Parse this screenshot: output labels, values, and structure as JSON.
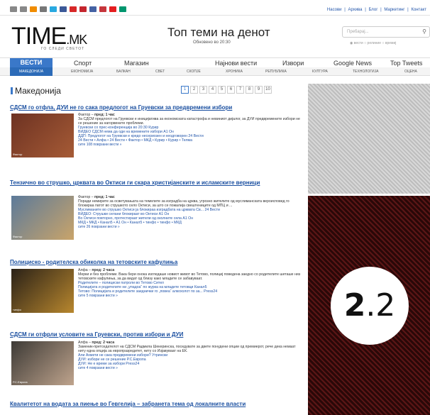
{
  "topbar": {
    "icons": [
      {
        "name": "grid-icon",
        "color": "#888"
      },
      {
        "name": "list-icon",
        "color": "#888"
      },
      {
        "name": "rss-icon",
        "color": "#f08c00"
      },
      {
        "name": "share-icon",
        "color": "#777"
      },
      {
        "name": "twitter-icon",
        "color": "#29a9e0"
      },
      {
        "name": "facebook-icon",
        "color": "#3b5998"
      },
      {
        "name": "flag-mk-icon",
        "color": "#d72828"
      },
      {
        "name": "flag-hr-icon",
        "color": "#c4262e"
      },
      {
        "name": "flag-us-icon",
        "color": "#4462a3"
      },
      {
        "name": "flag-rs-icon",
        "color": "#c6363c"
      },
      {
        "name": "flag-al-icon",
        "color": "#e41e20"
      },
      {
        "name": "flag-bg-icon",
        "color": "#00966e"
      }
    ],
    "links": [
      "Насови",
      "Архива",
      "Блог",
      "Маркетинг",
      "Контакт"
    ],
    "sep": "|"
  },
  "header": {
    "logo_main": "TIME",
    "logo_tld": ".MK",
    "tagline": "ГО СЛЕДИ СВЕТОТ",
    "headline": "Топ теми на денот",
    "updated": "Обновено во 20:30",
    "search_placeholder": "Пребарај...",
    "search_options": [
      "вести",
      "релиние",
      "времиј"
    ]
  },
  "nav": {
    "primary": [
      "ВЕСТИ",
      "Спорт",
      "Магазин",
      "Најнови вести",
      "Извори",
      "Google News",
      "Top Tweets"
    ],
    "secondary": [
      "МАКЕДОНИЈА",
      "ЕКОНОМИЈА",
      "БАЛКАН",
      "СВЕТ",
      "СКОПЈЕ",
      "ХРОНИКА",
      "РЕПУБЛИКА",
      "КУЛТУРА",
      "ТЕХНОЛОГИЈА",
      "ОЦЕНА"
    ]
  },
  "section": {
    "title": "Македонија",
    "pages": [
      "1",
      "2",
      "3",
      "4",
      "5",
      "6",
      "7",
      "8",
      "9",
      "10"
    ],
    "current_page": "1"
  },
  "articles": [
    {
      "title": "СДСМ го отфла, ДУИ не го сака предлогот на Груевски за предвремени избори",
      "source": "Фактор",
      "time": "пред: 1 час",
      "thumb_label": "Фактор",
      "thumb_colors": [
        "#6d3222",
        "#a65b36"
      ],
      "snippet": "За СДСМ предлогот на Груевски е иницијатива за економската катастрофа и невиниот дијалог, за ДУИ предвремените избори не се решение за нагорвените проблеми.",
      "related": [
        "Груевски со прес-конференција во 20:30 Курир",
        "ВИДЕО СДСМ нема да оди на времените избори А1 Он",
        "ДДП: Предлогот на Груевски е кредо несериозен и неодговорен 24 Вести",
        "24 Вести • Алфа • 24 Вести • Фактор • МКД • Курир • Курир • Телма"
      ],
      "more": "сите 108 поврзани вести »"
    },
    {
      "title": "Тензично во струшко, црквата во Октиси ги скара христијанските и исламските верници",
      "source": "Фактор",
      "time": "пред: 1 час",
      "thumb_label": "Фактор",
      "thumb_colors": [
        "#5c7a9a",
        "#c9a46a"
      ],
      "snippet": "Поради немирите за осветувањата на темелите за изградба на црква, угрозно жителите од муслиманската вероисповед го блокираа патот во струшкото село Октиси, за што се пожалија свештениците од МПЦ и ...",
      "related": [
        "Муслиманите во струшко Октиси ја блокираа изградбата на црквата Св... 24 Вести",
        "ВИДЕО: Струшки селани блокираат во Октиси А1 Он",
        "Во Октиси повторно, протестираат жители од околните села А1 Он",
        "МКД • МКД • Канал5 • А1 Он • Канал5 • тинфо • тинфо • МКД"
      ],
      "more": "сите 26 поврзани вести »"
    },
    {
      "title": "Полициско - родителска обиколка на тетовските кафулиња",
      "source": "Алфа",
      "time": "пред: 2 часа",
      "thumb_label": "тинфо",
      "thumb_colors": [
        "#2a2117",
        "#b8872e"
      ],
      "snippet": "Мерки и без проблеми. Вака бери онока изгледаше новиот живот во Тетово, полициј поведена заедно со родителите шеташе низ тетовските кафулиња, за да видат од близу како младите се забавуваат.",
      "related": [
        "Родителите – полициски патроли во Тетово Сител",
        "Полицијата и родителите ни „упадоа“ по журка на младите тетовци Канал5",
        "Тетово: Полицијата и родителите заеднички го „повеа“ алкохолот по за... Press24"
      ],
      "more": "сите 5 поврзани вести »"
    },
    {
      "title": "СДСМ ги отфрли условите на Груевски, против избори и ДУИ",
      "source": "Алфа",
      "time": "пред: 2 часа",
      "thumb_label": "Р.С.Европа",
      "thumb_colors": [
        "#3d3a36",
        "#bfa48d"
      ],
      "snippet": "Заменик-претседателот на СДСМ Радмила Шекеринска, поседувате за двете понудени опции од премиерот, рече дека немаат ниту една опција за европразредитет, ниту со Изјавуваат на ЕК.",
      "related": [
        "Али Ахмети не сака предвремени избори? Утрински",
        "ДУИ: избори не се решение Р.С.Европа",
        "ДУИ: Не е време за избори Press24"
      ],
      "more": "сите 4 поврзани вести »"
    },
    {
      "title": "Квалитетот на водата за пиење во Гевгелија – забранета тема од локалните власти"
    }
  ],
  "sidebar": {
    "version_major": "2",
    "version_minor": ".2",
    "ad_colors": [
      "#2a0808",
      "#5b1616"
    ]
  }
}
